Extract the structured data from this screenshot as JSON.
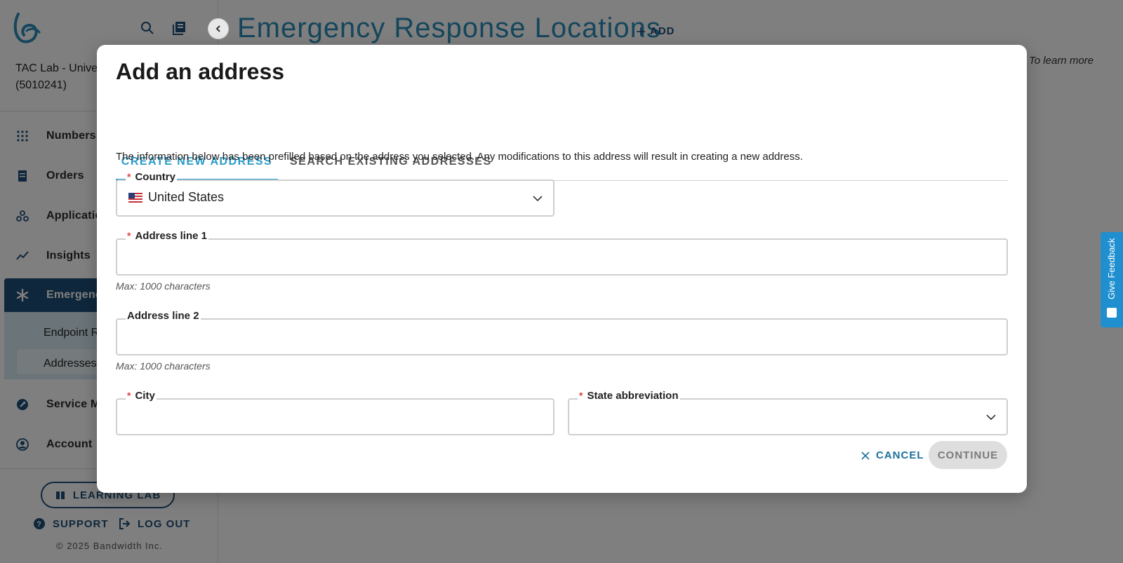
{
  "sidebar": {
    "account_name_line1": "TAC Lab - Univer",
    "account_name_line2": "(5010241)",
    "nav": [
      {
        "label": "Numbers",
        "icon": "grid-dots-icon"
      },
      {
        "label": "Orders",
        "icon": "orders-icon"
      },
      {
        "label": "Applicatio",
        "icon": "applications-icon"
      },
      {
        "label": "Insights",
        "icon": "insights-icon"
      },
      {
        "label": "Emergency",
        "icon": "asterisk-icon"
      },
      {
        "label": "Service Ma",
        "icon": "wrench-icon"
      },
      {
        "label": "Account",
        "icon": "account-icon"
      }
    ],
    "sub_items": [
      "Endpoint R",
      "Addresses"
    ],
    "learning_lab": "LEARNING LAB",
    "support": "SUPPORT",
    "logout": "LOG OUT",
    "copyright": "© 2025 Bandwidth Inc."
  },
  "page": {
    "title": "Emergency Response Locations",
    "add_label": "ADD",
    "learn_more": "To learn more"
  },
  "feedback": {
    "label": "Give Feedback"
  },
  "modal": {
    "title": "Add an address",
    "tabs": [
      "CREATE NEW ADDRESS",
      "SEARCH EXISTING ADDRESSES"
    ],
    "info": "The information below has been prefilled based on the address you selected. Any modifications to this address will result in creating a new address.",
    "country": {
      "label": "Country",
      "value": "United States",
      "required": true
    },
    "address1": {
      "label": "Address line 1",
      "value": "",
      "helper": "Max: 1000 characters",
      "required": true
    },
    "address2": {
      "label": "Address line 2",
      "value": "",
      "helper": "Max: 1000 characters",
      "required": false
    },
    "city": {
      "label": "City",
      "value": "",
      "required": true
    },
    "state": {
      "label": "State abbreviation",
      "value": "",
      "required": true
    },
    "cancel_label": "CANCEL",
    "continue_label": "CONTINUE",
    "required_mark": "*"
  },
  "colors": {
    "accent": "#2a9bc7",
    "nav_active": "#1e4f78",
    "required": "#e0453a"
  }
}
